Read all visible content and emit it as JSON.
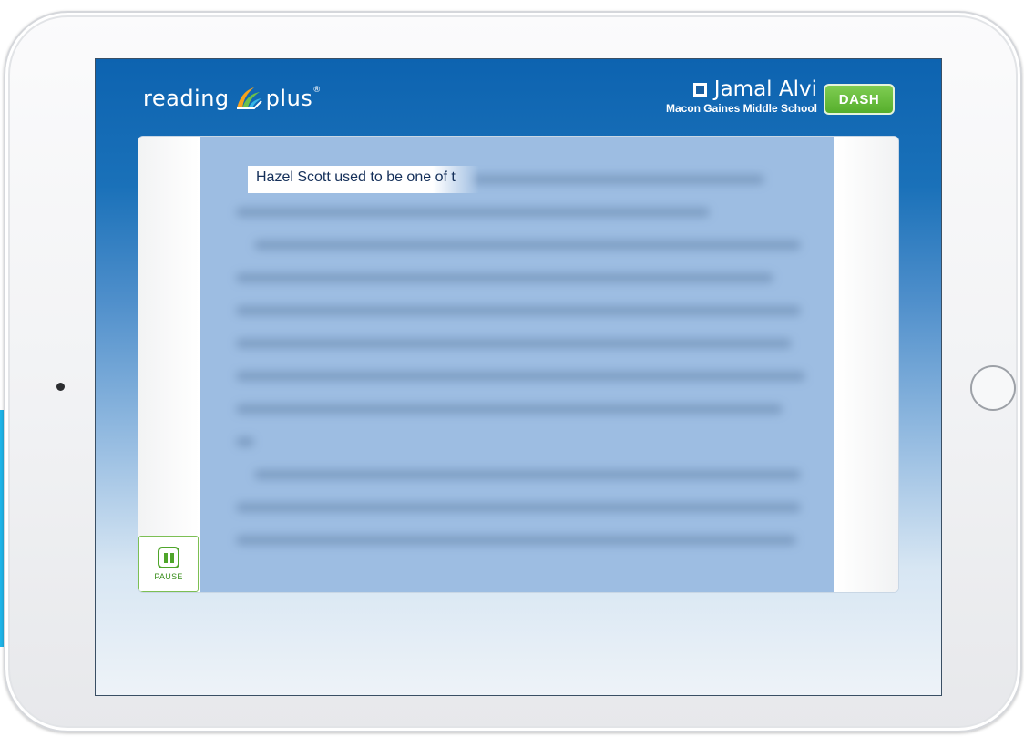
{
  "header": {
    "logo_text_left": "reading",
    "logo_text_right": "plus",
    "logo_registered": "®",
    "user_name": "Jamal Alvi",
    "school": "Macon Gaines Middle School",
    "dash_label": "DASH"
  },
  "reader": {
    "revealed_text": "Hazel Scott used to be one of t",
    "pause_label": "PAUSE"
  },
  "colors": {
    "header_blue": "#0d63b0",
    "dash_green": "#56ae2c",
    "text_area_blue": "#9dbde2",
    "pause_green": "#4fa52a"
  },
  "icons": {
    "logo": "reading-plus-logo-icon",
    "profile": "profile-icon",
    "pause": "pause-icon"
  }
}
